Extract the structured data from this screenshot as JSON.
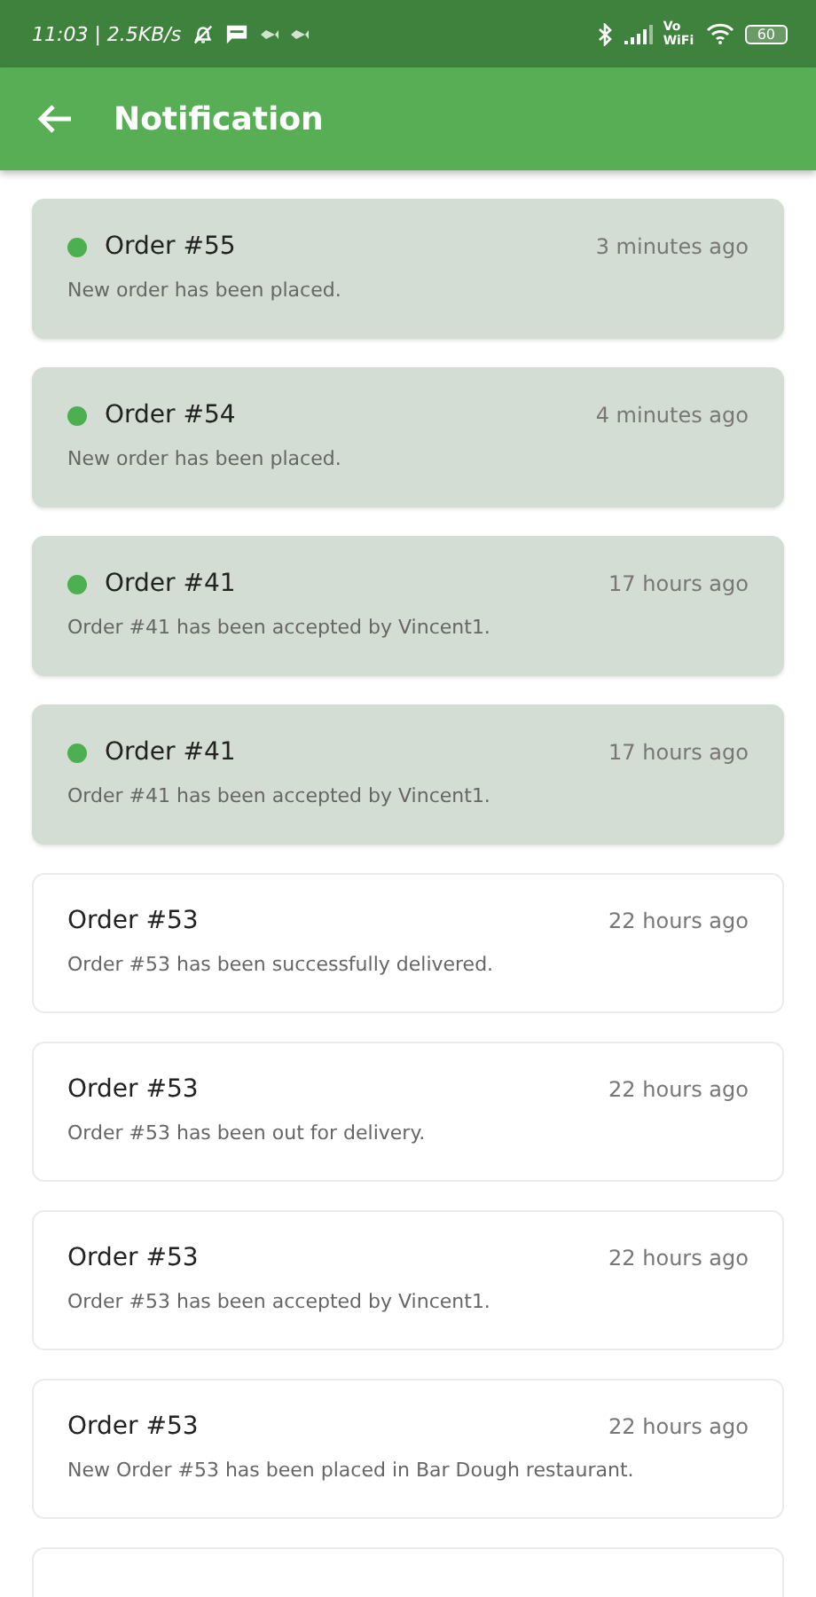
{
  "status_bar": {
    "time": "11:03 | 2.5KB/s",
    "wifi_label": "Vo WiFi",
    "battery": "60"
  },
  "app_bar": {
    "title": "Notification"
  },
  "notifications": [
    {
      "title": "Order #55",
      "time": "3 minutes ago",
      "message": "New order has been placed.",
      "unread": true
    },
    {
      "title": "Order #54",
      "time": "4 minutes ago",
      "message": "New order has been placed.",
      "unread": true
    },
    {
      "title": "Order #41",
      "time": "17 hours ago",
      "message": "Order #41 has been accepted by Vincent1.",
      "unread": true
    },
    {
      "title": "Order #41",
      "time": "17 hours ago",
      "message": "Order #41 has been accepted by Vincent1.",
      "unread": true
    },
    {
      "title": "Order #53",
      "time": "22 hours ago",
      "message": "Order #53 has been successfully delivered.",
      "unread": false
    },
    {
      "title": "Order #53",
      "time": "22 hours ago",
      "message": "Order #53 has been out for delivery.",
      "unread": false
    },
    {
      "title": "Order #53",
      "time": "22 hours ago",
      "message": "Order #53 has been accepted by Vincent1.",
      "unread": false
    },
    {
      "title": "Order #53",
      "time": "22 hours ago",
      "message": "New Order #53 has been placed in Bar Dough restaurant.",
      "unread": false
    },
    {
      "unread": false
    }
  ]
}
